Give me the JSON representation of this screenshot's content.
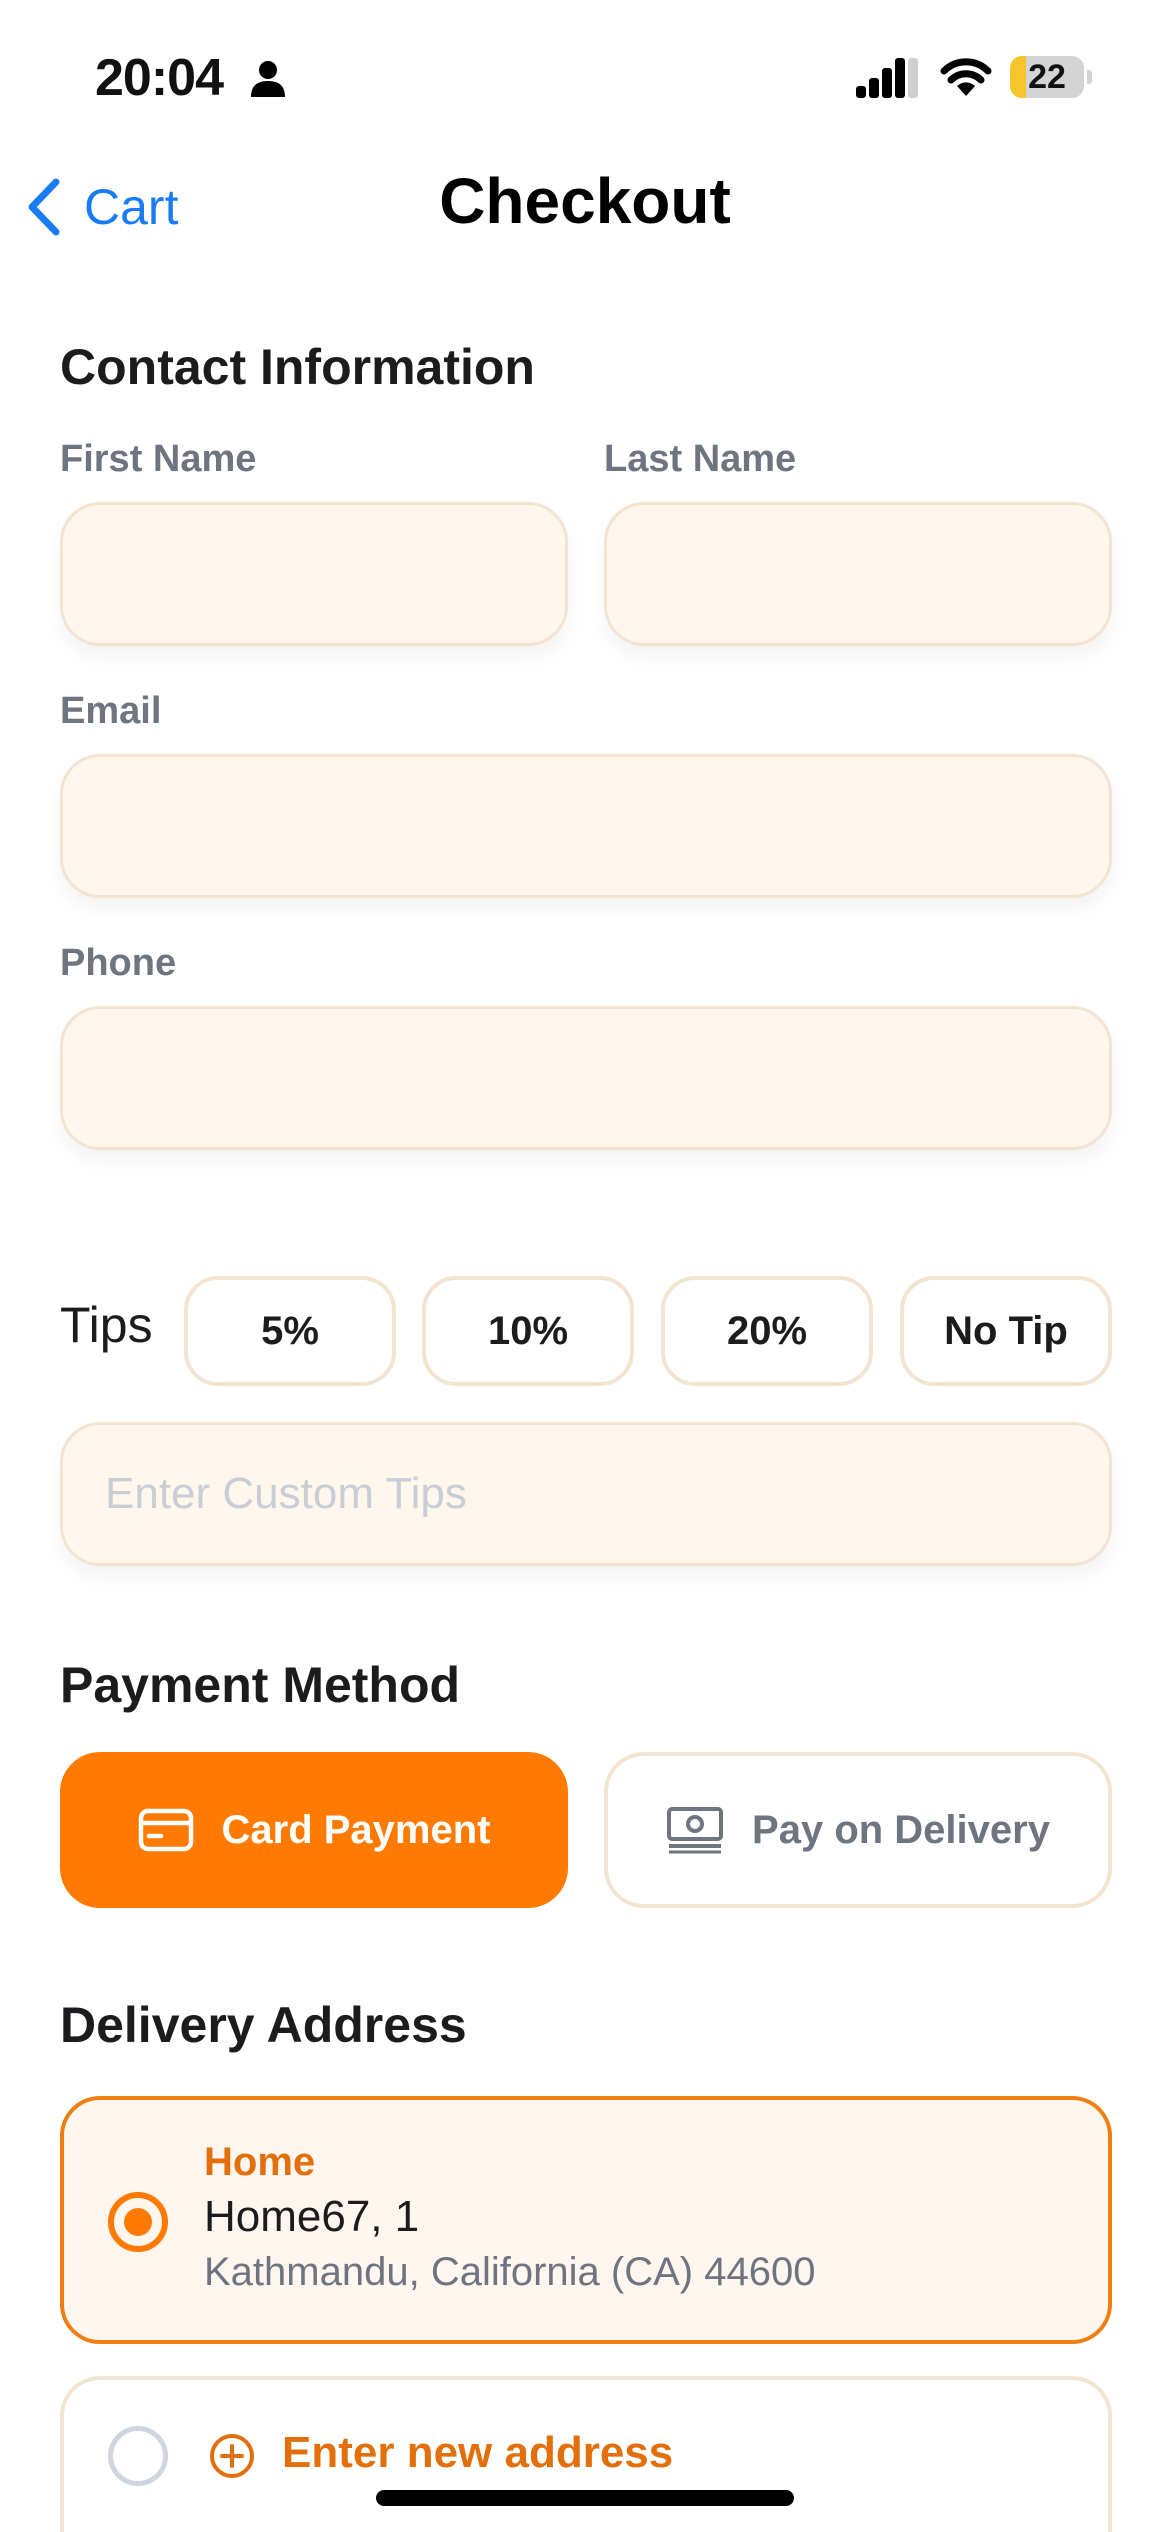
{
  "status_bar": {
    "time": "20:04",
    "battery": "22",
    "battery_level": 0.22
  },
  "nav": {
    "back_label": "Cart",
    "title": "Checkout"
  },
  "contact": {
    "section_title": "Contact Information",
    "first_name_label": "First Name",
    "last_name_label": "Last Name",
    "email_label": "Email",
    "phone_label": "Phone",
    "first_name_value": "",
    "last_name_value": "",
    "email_value": "",
    "phone_value": ""
  },
  "tips": {
    "label": "Tips",
    "options": [
      "5%",
      "10%",
      "20%",
      "No Tip"
    ],
    "custom_placeholder": "Enter Custom Tips",
    "custom_value": ""
  },
  "payment": {
    "section_title": "Payment Method",
    "card_label": "Card Payment",
    "delivery_label": "Pay on Delivery",
    "selected": "Card Payment"
  },
  "address": {
    "section_title": "Delivery Address",
    "saved": {
      "tag": "Home",
      "line1": "Home67, 1",
      "line2": "Kathmandu, California (CA) 44600",
      "selected": true
    },
    "new_label": "Enter new address"
  },
  "colors": {
    "accent": "#ff7a00",
    "link": "#1a7cf5",
    "field_bg": "#fff6ec",
    "field_border": "#f3e4d2"
  }
}
